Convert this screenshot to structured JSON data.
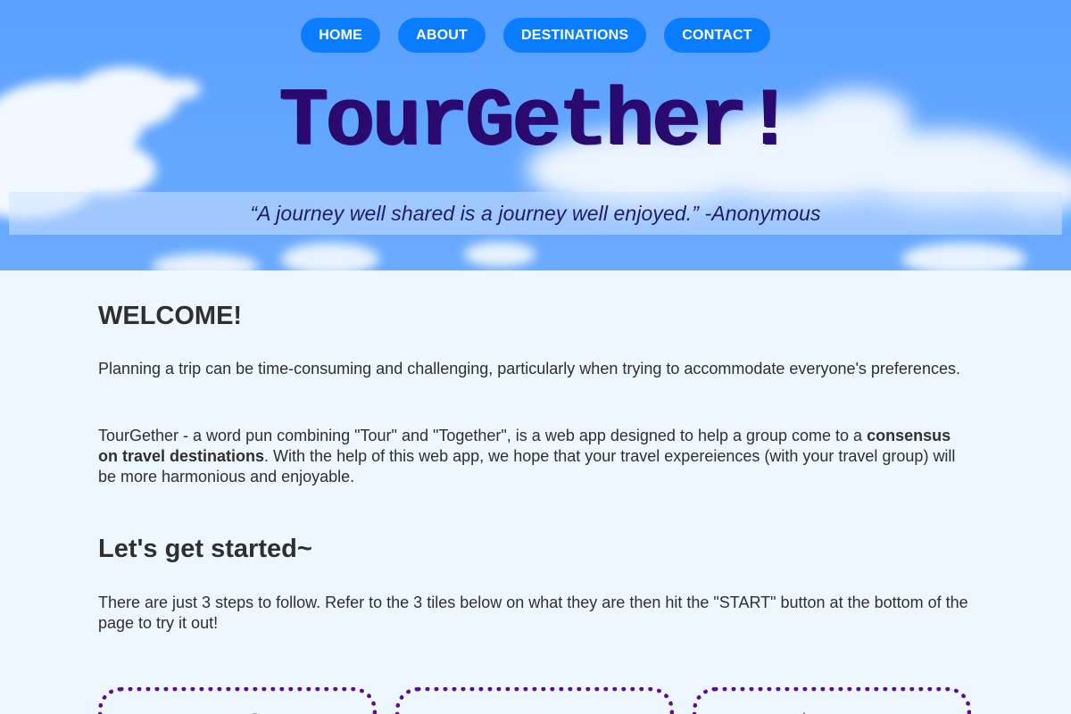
{
  "nav": {
    "items": [
      {
        "label": "HOME"
      },
      {
        "label": "ABOUT"
      },
      {
        "label": "DESTINATIONS"
      },
      {
        "label": "CONTACT"
      }
    ]
  },
  "hero": {
    "brand": "TourGether!",
    "quote": "“A journey well shared is a journey well enjoyed.” -Anonymous"
  },
  "welcome": {
    "title": "WELCOME!",
    "paragraph1": "Planning a trip can be time-consuming and challenging, particularly when trying to accommodate everyone's preferences.",
    "paragraph2_before": "TourGether - a word pun combining \"Tour\" and \"Together\", is a web app designed to help a group come to a ",
    "paragraph2_bold": "consensus on travel destinations",
    "paragraph2_after": ". With the help of this web app, we hope that your travel expereiences (with your travel group) will be more harmonious and enjoyable."
  },
  "getting_started": {
    "title": "Let's get started~",
    "paragraph": "There are just 3 steps to follow. Refer to the 3 tiles below on what they are then hit the \"START\" button at the bottom of the page to try it out!"
  },
  "colors": {
    "sky": "#5aa0ff",
    "nav_button": "#0a7cff",
    "brand_text": "#2a0a6e",
    "tile_border": "#5b0f8f",
    "page_background": "#eef6ff"
  }
}
